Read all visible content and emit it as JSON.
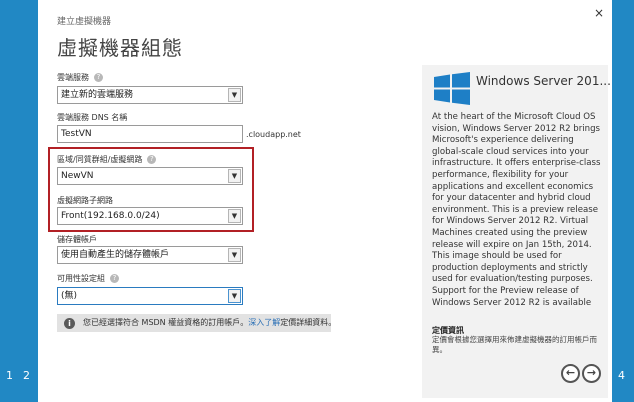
{
  "wizard": {
    "breadcrumb": "建立虛擬機器",
    "title": "虛擬機器組態",
    "close_label": "×",
    "steps_left": [
      "1",
      "2"
    ],
    "steps_right": [
      "4"
    ]
  },
  "form": {
    "cloud_service": {
      "label": "雲端服務",
      "value": "建立新的雲端服務"
    },
    "dns_name": {
      "label": "雲端服務 DNS 名稱",
      "value": "TestVN",
      "suffix": ".cloudapp.net"
    },
    "region": {
      "label": "區域/同質群組/虛擬網路",
      "value": "NewVN"
    },
    "subnet": {
      "label": "虛擬網路子網路",
      "value": "Front(192.168.0.0/24)"
    },
    "storage": {
      "label": "儲存體帳戶",
      "value": "使用自動產生的儲存體帳戶"
    },
    "availability": {
      "label": "可用性設定組",
      "value": "(無)"
    }
  },
  "info_bar": {
    "text": "您已經選擇符合 MSDN 權益資格的訂用帳戶。",
    "link": "深入了解",
    "text_after": "定價詳細資料。"
  },
  "side_panel": {
    "title": "Windows Server 201...",
    "description": "At the heart of the Microsoft Cloud OS vision, Windows Server 2012 R2 brings Microsoft's experience delivering global-scale cloud services into your infrastructure. It offers enterprise-class performance, flexibility for your applications and excellent economics for your datacenter and hybrid cloud environment. This is a preview release for Windows Server 2012 R2. Virtual Machines created using the preview release will expire on Jan 15th, 2014. This image should be used for production deployments and strictly used for evaluation/testing purposes. Support for the Preview release of Windows Server 2012 R2 is available through",
    "pricing_title": "定價資訊",
    "pricing_desc": "定價會根據您選擇用來佈建虛擬機器的訂用帳戶而異。"
  },
  "navigation": {
    "prev_label": "←",
    "next_label": "→"
  },
  "icons": {
    "help": "question-circle-icon",
    "info": "info-circle-icon",
    "dropdown": "chevron-down-icon",
    "logo": "windows-logo-icon"
  },
  "colors": {
    "accent": "#2188c4",
    "highlight": "#b22025",
    "windows_logo": "#1e7fc6"
  }
}
